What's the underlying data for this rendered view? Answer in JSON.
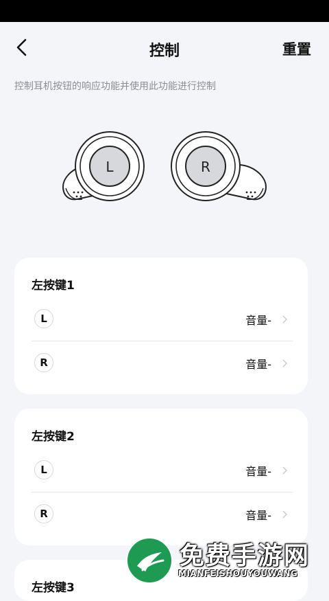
{
  "header": {
    "title": "控制",
    "reset_label": "重置"
  },
  "description": "控制耳机按钮的响应功能并使用此功能进行控制",
  "earbuds": {
    "left_glyph": "L",
    "right_glyph": "R"
  },
  "cards": [
    {
      "title": "左按键1",
      "rows": [
        {
          "side": "L",
          "value": "音量-"
        },
        {
          "side": "R",
          "value": "音量-"
        }
      ]
    },
    {
      "title": "左按键2",
      "rows": [
        {
          "side": "L",
          "value": "音量-"
        },
        {
          "side": "R",
          "value": "音量-"
        }
      ]
    },
    {
      "title": "左按键3"
    }
  ],
  "watermark": {
    "title": "免费手游网",
    "subtitle": "MIANFEISHOUYOUWANG"
  },
  "colors": {
    "background": "#f4f5f9",
    "card": "#ffffff",
    "muted_text": "#8a8d94",
    "watermark_green": "#1f9a53"
  }
}
